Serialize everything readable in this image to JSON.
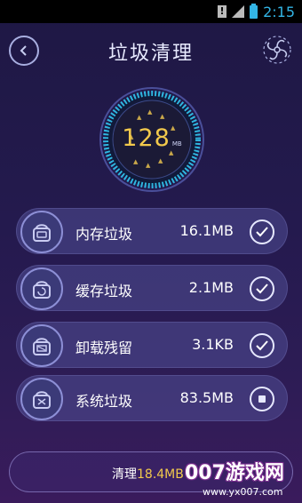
{
  "status_bar": {
    "time": "2:15",
    "alert": "!"
  },
  "header": {
    "title": "垃圾清理"
  },
  "gauge": {
    "value": "128",
    "unit": "MB"
  },
  "items": [
    {
      "label": "内存垃圾",
      "size": "16.1MB",
      "state": "checked",
      "icon": "android-robot-icon"
    },
    {
      "label": "缓存垃圾",
      "size": "2.1MB",
      "state": "checked",
      "icon": "android-cache-icon"
    },
    {
      "label": "卸载残留",
      "size": "3.1KB",
      "state": "checked",
      "icon": "android-uninstall-icon"
    },
    {
      "label": "系统垃圾",
      "size": "83.5MB",
      "state": "scanning",
      "icon": "android-system-icon"
    }
  ],
  "clean_button": {
    "prefix": "清理",
    "amount": "18.4MB"
  },
  "watermark": {
    "brand": "007游戏网",
    "url": "www.yx007.com"
  },
  "colors": {
    "accent_yellow": "#f2c94c",
    "ring_cyan": "#2fb6e0",
    "status_time": "#33b5e5"
  }
}
